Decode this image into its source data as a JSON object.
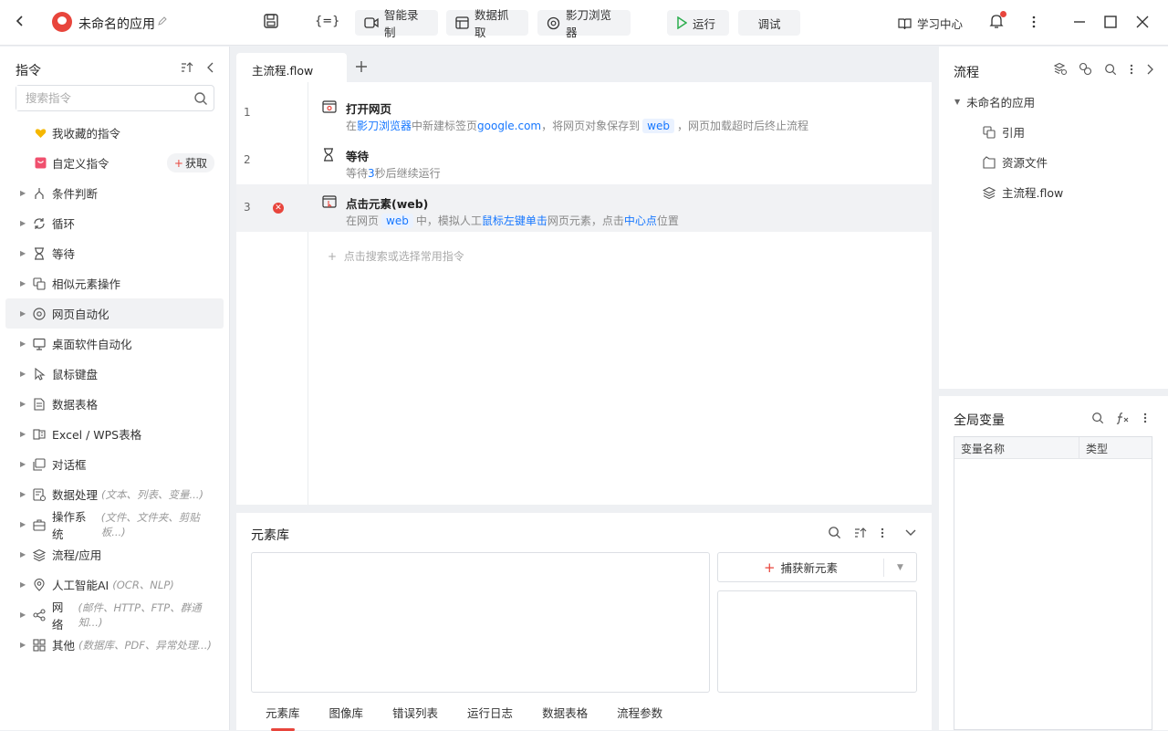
{
  "app": {
    "title": "未命名的应用"
  },
  "toolbar": {
    "format_label": "{=}",
    "record_label": "智能录制",
    "scrape_label": "数据抓取",
    "browser_label": "影刀浏览器",
    "run_label": "运行",
    "debug_label": "调试",
    "learn_label": "学习中心"
  },
  "commands": {
    "header": "指令",
    "search_placeholder": "搜索指令",
    "favorites": "我收藏的指令",
    "custom": "自定义指令",
    "get_label": "获取",
    "items": [
      {
        "label": "条件判断",
        "icon": "branch-icon",
        "hint": ""
      },
      {
        "label": "循环",
        "icon": "loop-icon",
        "hint": ""
      },
      {
        "label": "等待",
        "icon": "hourglass-icon",
        "hint": ""
      },
      {
        "label": "相似元素操作",
        "icon": "copy-icon",
        "hint": ""
      },
      {
        "label": "网页自动化",
        "icon": "browser-icon",
        "hint": ""
      },
      {
        "label": "桌面软件自动化",
        "icon": "monitor-icon",
        "hint": ""
      },
      {
        "label": "鼠标键盘",
        "icon": "cursor-icon",
        "hint": ""
      },
      {
        "label": "数据表格",
        "icon": "document-icon",
        "hint": ""
      },
      {
        "label": "Excel / WPS表格",
        "icon": "excel-icon",
        "hint": ""
      },
      {
        "label": "对话框",
        "icon": "dialog-icon",
        "hint": ""
      },
      {
        "label": "数据处理",
        "icon": "data-icon",
        "hint": "(文本、列表、变量...)"
      },
      {
        "label": "操作系统",
        "icon": "toolbox-icon",
        "hint": "(文件、文件夹、剪贴板...)"
      },
      {
        "label": "流程/应用",
        "icon": "layers-icon",
        "hint": ""
      },
      {
        "label": "人工智能AI",
        "icon": "ai-icon",
        "hint": "(OCR、NLP)"
      },
      {
        "label": "网络",
        "icon": "share-icon",
        "hint": "(邮件、HTTP、FTP、群通知...)"
      },
      {
        "label": "其他",
        "icon": "grid-icon",
        "hint": "(数据库、PDF、异常处理...)"
      }
    ]
  },
  "editor": {
    "tab": "主流程.flow",
    "add_hint": "点击搜索或选择常用指令",
    "steps": [
      {
        "num": "1",
        "title": "打开网页",
        "d1": "在",
        "d2": "影刀浏览器",
        "d3": "中新建标签页",
        "d4": "google.com",
        "d5": "，将网页对象保存到",
        "d6": "web",
        "d7": "，网页加载超时后终止流程"
      },
      {
        "num": "2",
        "title": "等待",
        "d1": "等待",
        "d2": "3",
        "d3": "秒后继续运行"
      },
      {
        "num": "3",
        "title": "点击元素(web)",
        "d1": "在网页",
        "d2": "web",
        "d3": "中，模拟人工",
        "d4": "鼠标左键单击",
        "d5": "网页元素，点击",
        "d6": "中心点",
        "d7": "位置"
      }
    ]
  },
  "elements": {
    "title": "元素库",
    "capture_label": "捕获新元素",
    "tabs": [
      "元素库",
      "图像库",
      "错误列表",
      "运行日志",
      "数据表格",
      "流程参数"
    ]
  },
  "flow_panel": {
    "title": "流程",
    "root": "未命名的应用",
    "items": [
      "引用",
      "资源文件",
      "主流程.flow"
    ]
  },
  "vars_panel": {
    "title": "全局变量",
    "col_name": "变量名称",
    "col_type": "类型"
  },
  "colors": {
    "accent": "#e8453c",
    "link": "#1677ff",
    "run": "#2dae4f"
  }
}
